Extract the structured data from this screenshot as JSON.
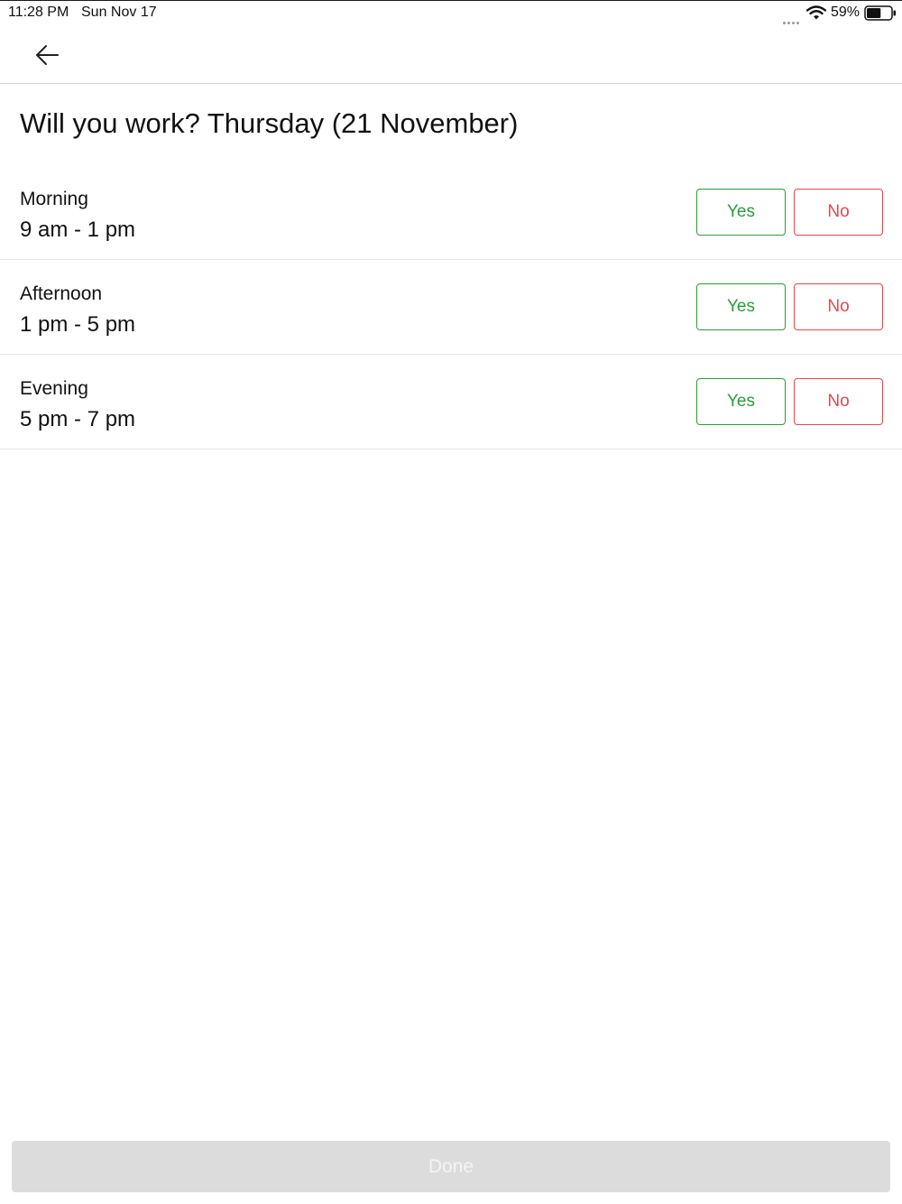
{
  "status_bar": {
    "time": "11:28 PM",
    "date": "Sun Nov 17",
    "battery_percent": "59%",
    "battery_level": 0.59
  },
  "nav": {
    "back_icon": "arrow-left-icon"
  },
  "title": "Will you work? Thursday (21 November)",
  "shifts": [
    {
      "name": "Morning",
      "time": "9 am - 1 pm",
      "yes_label": "Yes",
      "no_label": "No"
    },
    {
      "name": "Afternoon",
      "time": "1 pm - 5 pm",
      "yes_label": "Yes",
      "no_label": "No"
    },
    {
      "name": "Evening",
      "time": "5 pm - 7 pm",
      "yes_label": "Yes",
      "no_label": "No"
    }
  ],
  "done_label": "Done",
  "done_enabled": false,
  "colors": {
    "yes": "#2e9a3e",
    "no": "#e8464e",
    "done_disabled_bg": "#dcdcdc"
  }
}
